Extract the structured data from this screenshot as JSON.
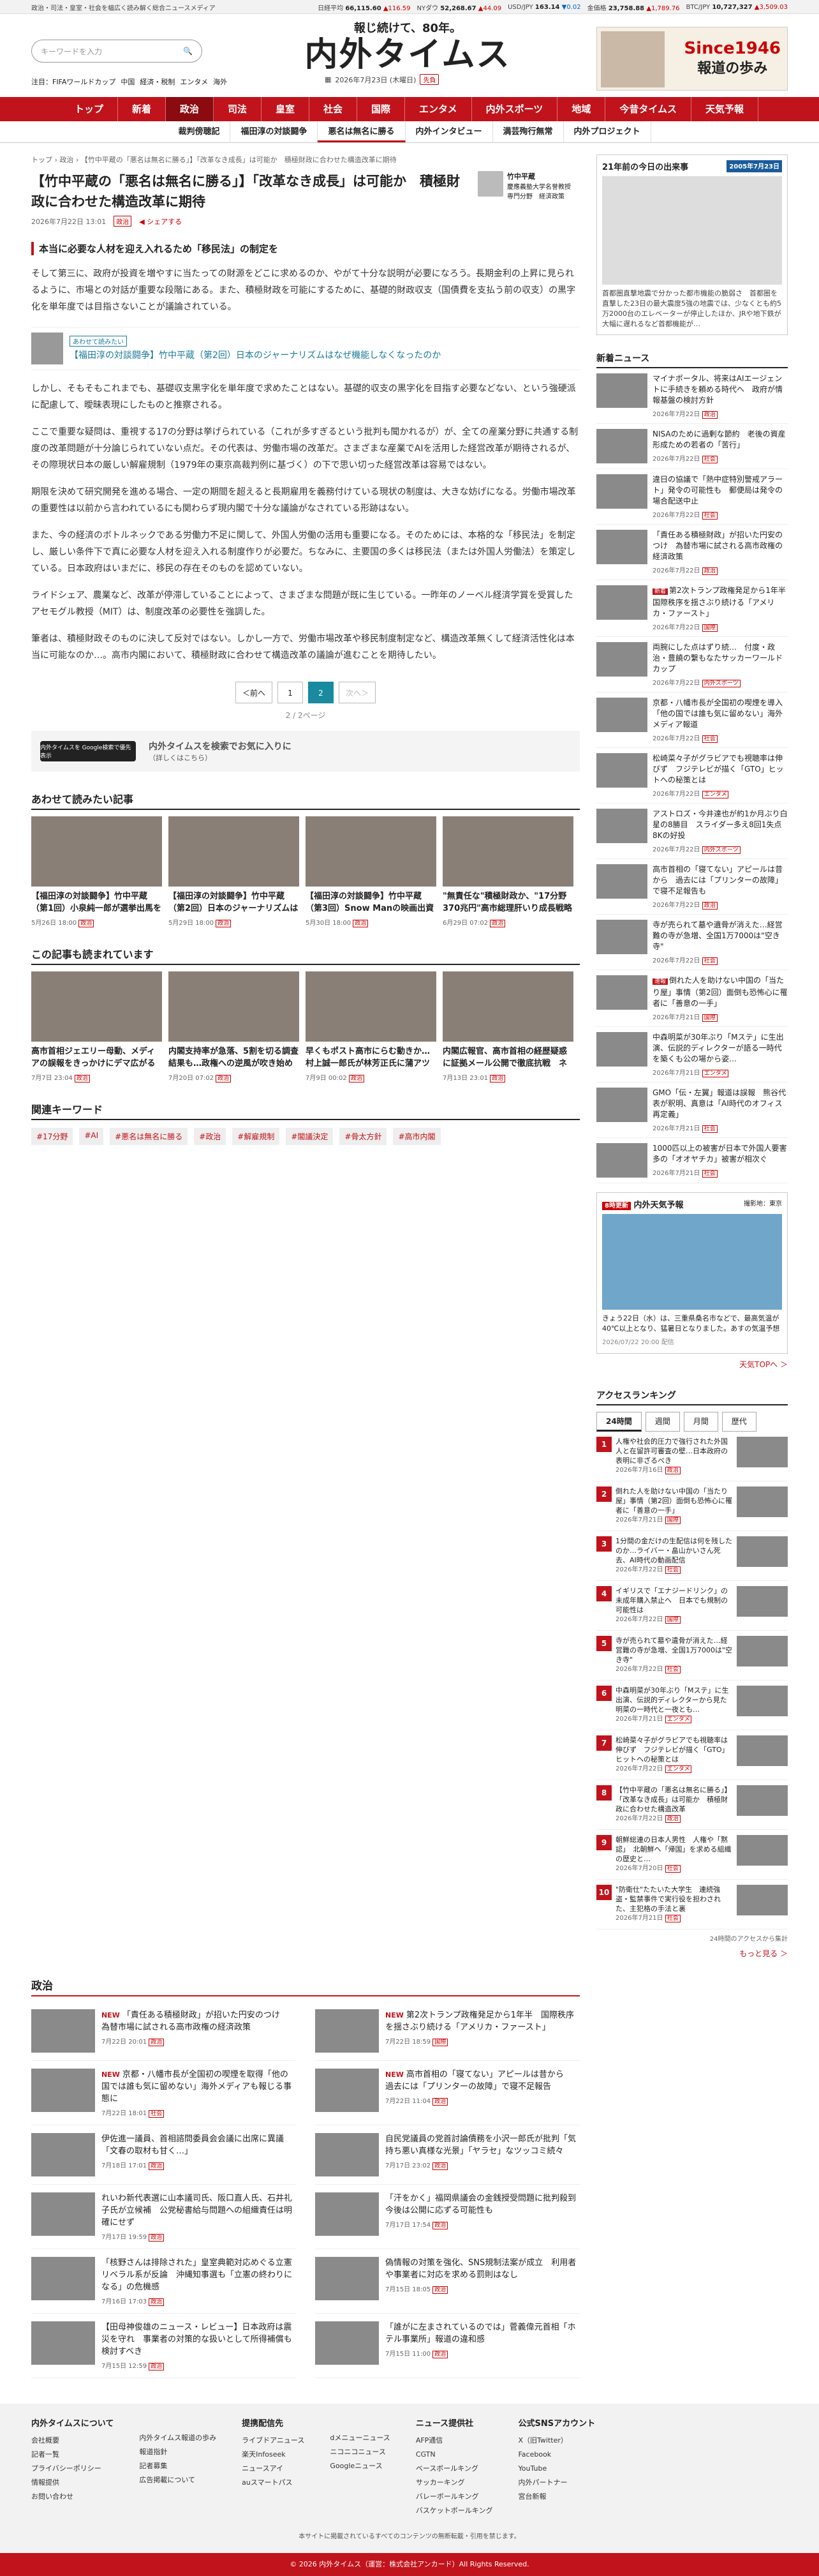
{
  "topbar": {
    "left": "政治・司法・皇室・社会を幅広く読み解く総合ニュースメディア",
    "markets": [
      {
        "name": "日経平均",
        "val": "66,115.60",
        "chg": "▲116.59",
        "dir": "up"
      },
      {
        "name": "NYダウ",
        "val": "52,268.67",
        "chg": "▲44.09",
        "dir": "up"
      },
      {
        "name": "USD/JPY",
        "val": "163.14",
        "chg": "▼0.02",
        "dir": "dn"
      },
      {
        "name": "金価格",
        "val": "23,758.88",
        "chg": "▲1,789.76",
        "dir": "up"
      },
      {
        "name": "BTC/JPY",
        "val": "10,727,327",
        "chg": "▲3,509.03",
        "dir": "up"
      }
    ]
  },
  "header": {
    "search_placeholder": "キーワードを入力",
    "tagline": "報じ続けて、80年。",
    "logo": "内外タイムス",
    "date": "2026年7月23日 (木曜日)",
    "weekday": "先負",
    "topnav": [
      "注目：FIFAワールドカップ",
      "中国",
      "経済・税制",
      "エンタメ",
      "海外"
    ],
    "ad": {
      "since": "Since1946",
      "sub": "報道の歩み"
    }
  },
  "mainnav": [
    "トップ",
    "新着",
    "政治",
    "司法",
    "皇室",
    "社会",
    "国際",
    "エンタメ",
    "内外スポーツ",
    "地域",
    "今昔タイムス",
    "天気予報"
  ],
  "mainnav_active": "政治",
  "subnav": [
    "裁判傍聴記",
    "福田淳の対談闘争",
    "悪名は無名に勝る",
    "内外インタビュー",
    "満芸殉行無常",
    "内外プロジェクト"
  ],
  "subnav_active": "悪名は無名に勝る",
  "article": {
    "breadcrumb": "トップ › 政治 › 【竹中平蔵の「悪名は無名に勝る」】「改革なき成長」は可能か　積極財政に合わせた構造改革に期待",
    "title": "【竹中平蔵の「悪名は無名に勝る」】「改革なき成長」は可能か　積極財政に合わせた構造改革に期待",
    "date": "2026年7月22日 13:01",
    "cat": "政治",
    "share": "シェアする",
    "author": {
      "name": "竹中平蔵",
      "role": "慶應義塾大学名誉教授",
      "tag": "専門分野　経済政策"
    },
    "lead": "本当に必要な人材を迎え入れるため「移民法」の制定を",
    "p1": "そして第三に、政府が投資を増やすに当たっての財源をどこに求めるのか、やがて十分な説明が必要になろう。長期金利の上昇に見られるように、市場との対話が重要な段階にある。また、積極財政を可能にするために、基礎的財政収支（国債費を支払う前の収支）の黒字化を単年度では目指さないことが議論されている。",
    "related": {
      "label": "あわせて読みたい",
      "text": "【福田淳の対談闘争】竹中平蔵（第2回）日本のジャーナリズムはなぜ機能しなくなったのか"
    },
    "p2": "しかし、そもそもこれまでも、基礎収支黒字化を単年度で求めたことはない。基礎的収支の黒字化を目指す必要などない、という強硬派に配慮して、曖昧表現にしたものと推察される。",
    "p3": "ここで重要な疑問は、重視する17の分野は挙げられている（これが多すぎるという批判も聞かれるが）が、全ての産業分野に共通する制度の改革問題が十分論じられていない点だ。その代表は、労働市場の改革だ。さまざまな産業でAIを活用した経営改革が期待されるが、その際現状日本の厳しい解雇規制（1979年の東京高裁判例に基づく）の下で思い切った経営改革は容易ではない。",
    "p4": "期限を決めて研究開発を進める場合、一定の期間を超えると長期雇用を義務付けている現状の制度は、大きな妨げになる。労働市場改革の重要性は以前から言われているにも関わらず現内閣で十分な議論がなされている形跡はない。",
    "p5": "また、今の経済のボトルネックである労働力不足に関して、外国人労働の活用も重要になる。そのためには、本格的な「移民法」を制定し、厳しい条件下で真に必要な人材を迎え入れる制度作りが必要だ。ちなみに、主要国の多くは移民法（または外国人労働法）を策定している。日本政府はいまだに、移民の存在そのものを認めていない。",
    "p6": "ライドシェア、農業など、改革が停滞していることによって、さまざまな問題が既に生じている。一昨年のノーベル経済学賞を受賞したアセモグル教授（MIT）は、制度改革の必要性を強調した。",
    "p7": "筆者は、積極財政そのものに決して反対ではない。しかし一方で、労働市場改革や移民制度制定など、構造改革無くして経済活性化は本当に可能なのか…。高市内閣において、積極財政に合わせて構造改革の議論が進むことを期待したい。",
    "pager": {
      "prev": "＜前へ",
      "p1": "1",
      "p2": "2",
      "next": "次へ＞",
      "text": "2 / 2ページ"
    },
    "google": {
      "btn": "内外タイムスを Google検索で優先表示",
      "title": "内外タイムスを検索でお気に入りに",
      "sub": "（詳しくはこちら）"
    }
  },
  "recommend": {
    "title": "あわせて読みたい記事",
    "items": [
      {
        "t": "【福田淳の対談闘争】竹中平蔵（第1回）小泉純一郎が選挙出馬を断らず…",
        "d": "5月26日 18:00",
        "c": "政治"
      },
      {
        "t": "【福田淳の対談闘争】竹中平蔵（第2回）日本のジャーナリズムはなぜ機能…",
        "d": "5月29日 18:00",
        "c": "政治"
      },
      {
        "t": "【福田淳の対談闘争】竹中平蔵（第3回）Snow Manの映画出資付が満喫…",
        "d": "5月30日 18:00",
        "c": "政治"
      },
      {
        "t": "\"無責任な\"積極財政か、\"17分野370兆円\"高市総理肝いり成長戦略投資",
        "d": "6月29日 07:02",
        "c": "政治"
      }
    ]
  },
  "popular": {
    "title": "この記事も読まれています",
    "items": [
      {
        "t": "高市首相ジェエリー母動、メディアの誤報をきっかけにデマ広がる　いまだ中傷…",
        "d": "7月7日 23:04",
        "c": "政治"
      },
      {
        "t": "内閣支持率が急落、5割を切る調査結果も…政権への逆風が吹き始めた転換点か",
        "d": "7月20日 07:02",
        "c": "政治"
      },
      {
        "t": "早くもポスト高市にらむ動きか…村上誠一郎氏が林芳正氏に蒲アツのエール",
        "d": "7月9日 00:02",
        "c": "政治"
      },
      {
        "t": "内閣広報官、高市首相の経歴疑惑に証拠メール公開で徹底抗戦　ネットは賛否…",
        "d": "7月13日 23:01",
        "c": "政治"
      }
    ]
  },
  "keywords": {
    "title": "関連キーワード",
    "items": [
      "#17分野",
      "#AI",
      "#悪名は無名に勝る",
      "#政治",
      "#解雇規制",
      "#閣議決定",
      "#骨太方針",
      "#高市内閣"
    ]
  },
  "today": {
    "title": "21年前の今日の出来事",
    "year": "2005年7月23日",
    "text": "首都圏直撃地震で分かった都市機能の脆弱さ　首都圏を直撃した23日の最大震度5強の地震では、少なくとも約5万2000台のエレベーターが停止したほか、JRや地下鉄が大幅に遅れるなど首都機能が…"
  },
  "shin": {
    "title": "新着ニュース",
    "items": [
      {
        "t": "マイナポータル、将来はAIエージェントに手続きを頼める時代へ　政府が情報基盤の検討方針",
        "d": "2026年7月22日",
        "c": "政治"
      },
      {
        "t": "NISAのために過剰な節約　老後の資産形成ための若者の「苦行」",
        "d": "2026年7月22日",
        "c": "社会"
      },
      {
        "t": "違日の協議で「熱中症特別警戒アラート」発令の可能性も　郵便局は発令の場合配送中止",
        "d": "2026年7月22日",
        "c": "社会"
      },
      {
        "t": "「責任ある積極財政」が招いた円安のつけ　為替市場に試される高市政権の経済政策",
        "d": "2026年7月22日",
        "c": "政治"
      },
      {
        "t": "第2次トランプ政権発足から1年半　国際秩序を揺さぶり続ける「アメリカ・ファースト」",
        "d": "2026年7月22日",
        "c": "国際",
        "new": "新着"
      },
      {
        "t": "両腕にした点はずり続…　付度・政治・豊饒の繋もなたサッカーワールドカップ",
        "d": "2026年7月22日",
        "c": "内外スポーツ"
      },
      {
        "t": "京都・八幡市長が全国初の喫煙を導入「他の国では誰も気に留めない」海外メディア報道",
        "d": "2026年7月22日",
        "c": "社会"
      },
      {
        "t": "松崎菜々子がグラビアでも視聴率は伸びず　フジテレビが描く「GTO」ヒットへの秘策とは",
        "d": "2026年7月22日",
        "c": "エンタメ"
      },
      {
        "t": "アストロズ・今井達也が約1か月ぶり白星の8勝目　スライダー多え8回1失点8Kの好投",
        "d": "2026年7月22日",
        "c": "内外スポーツ"
      },
      {
        "t": "高市首相の「寝てない」アピールは昔から　過去には「プリンターの故障」で寝不足報告も",
        "d": "2026年7月22日",
        "c": "政治"
      },
      {
        "t": "寺が売られて墓や遺骨が消えた…経営難の寺が急増、全国1万7000は\"空き寺\"",
        "d": "2026年7月22日",
        "c": "社会"
      },
      {
        "t": "倒れた人を助けない中国の「当たり屋」事情（第2回）面倒も恐怖心に罹者に「善意の一手」",
        "d": "2026年7月21日",
        "c": "国際",
        "new": "速報"
      },
      {
        "t": "中森明菜が30年ぶり「Mステ」に生出演、伝説的ディレクターが語る一時代を築くも公の場から姿…",
        "d": "2026年7月21日",
        "c": "エンタメ"
      },
      {
        "t": "GMO「伝・左翼」報道は誤報　熊谷代表が釈明、真意は「AI時代のオフィス再定義」",
        "d": "2026年7月21日",
        "c": "社会"
      },
      {
        "t": "1000匹以上の被害が日本で外国人要害多の「オオヤチカ」被害が相次ぐ",
        "d": "2026年7月21日",
        "c": "社会"
      }
    ]
  },
  "weather": {
    "title": "内外天気予報",
    "badge": "8時更新",
    "loc": "撮影地：東京",
    "text": "きょう22日（水）は、三重県桑名市などで、最高気温が40℃以上となり、猛暑日となりました。あすの気温予想",
    "date": "2026/07/22 20:00 配信",
    "more": "天気TOPへ ＞"
  },
  "rank": {
    "title": "アクセスランキング",
    "tabs": [
      "24時間",
      "週間",
      "月間",
      "歴代"
    ],
    "items": [
      {
        "n": "1",
        "t": "人権や社会的圧力で強行された外国人と在留許可審査の壁…日本政府の表明に非ざるべき",
        "d": "2026年7月16日",
        "c": "政治"
      },
      {
        "n": "2",
        "t": "倒れた人を助けない中国の「当たり屋」事情（第2回）面倒も恐怖心に罹者に「善意の一手」",
        "d": "2026年7月21日",
        "c": "国際"
      },
      {
        "n": "3",
        "t": "1分間の金だけの生配信は何を残したのか…ライバー・畠山かいさん死去、AI時代の動画配信",
        "d": "2026年7月22日",
        "c": "社会"
      },
      {
        "n": "4",
        "t": "イギリスで「エナジードリンク」の未成年購入禁止へ　日本でも規制の可能性は",
        "d": "2026年7月22日",
        "c": "国際"
      },
      {
        "n": "5",
        "t": "寺が売られて墓や遺骨が消えた…経営難の寺が急増、全国1万7000は\"空き寺\"",
        "d": "2026年7月22日",
        "c": "社会"
      },
      {
        "n": "6",
        "t": "中森明菜が30年ぶり「Mステ」に生出演、伝説的ディレクターから見た明菜の一時代と一夜とも…",
        "d": "2026年7月21日",
        "c": "エンタメ"
      },
      {
        "n": "7",
        "t": "松崎菜々子がグラビアでも視聴率は伸びず　フジテレビが描く「GTO」ヒットへの秘策とは",
        "d": "2026年7月22日",
        "c": "エンタメ"
      },
      {
        "n": "8",
        "t": "【竹中平蔵の「悪名は無名に勝る」】「改革なき成長」は可能か　積極財政に合わせた構造改革",
        "d": "2026年7月22日",
        "c": "政治"
      },
      {
        "n": "9",
        "t": "朝鮮総連の日本人男性　人権や「黙認」　北朝鮮へ「帰国」を求める組織の歴史と…",
        "d": "2026年7月20日",
        "c": "社会"
      },
      {
        "n": "10",
        "t": "\"防衛仕\"たたいた大学生　連続強盗・監禁事件で実行役を担わされた、主犯格の手法と裏",
        "d": "2026年7月21日",
        "c": "社会"
      }
    ],
    "note": "24時間のアクセスから集計",
    "more": "もっと見る ＞"
  },
  "politics": {
    "title": "政治",
    "items": [
      {
        "t": "「責任ある積極財政」が招いた円安のつけ　為替市場に試される高市政権の経済政策",
        "d": "7月22日 20:01",
        "c": "政治",
        "new": "NEW"
      },
      {
        "t": "第2次トランプ政権発足から1年半　国際秩序を揺さぶり続ける「アメリカ・ファースト」",
        "d": "7月22日 18:59",
        "c": "国際",
        "new": "NEW"
      },
      {
        "t": "京都・八幡市長が全国初の喫煙を取得「他の国では誰も気に留めない」海外メディアも報じる事態に",
        "d": "7月22日 18:01",
        "c": "社会",
        "new": "NEW"
      },
      {
        "t": "高市首相の「寝てない」アピールは昔から　過去には「プリンターの故障」で寝不足報告",
        "d": "7月22日 11:04",
        "c": "政治",
        "new": "NEW"
      },
      {
        "t": "伊佐進一議員、首相諮問委員会会議に出席に異議「文春の取材も甘く…」",
        "d": "7月18日 17:01",
        "c": "政治"
      },
      {
        "t": "自民党議員の党首討論債務を小沢一郎氏が批判「気持ち悪い真様な光景」「ヤラセ」なツッコミ続々",
        "d": "7月17日 23:02",
        "c": "政治"
      },
      {
        "t": "れいわ新代表選に山本議司氏、阪口直人氏、石井礼子氏が立候補　公党秘書給与問題への組織責任は明確にせず",
        "d": "7月17日 19:59",
        "c": "政治"
      },
      {
        "t": "「汗をかく」福岡県議会の金銭授受問題に批判殺到　今後は公開に応ずる可能性も",
        "d": "7月17日 17:54",
        "c": "政治"
      },
      {
        "t": "「核野さんは排除された」皇室典範対応めぐる立憲リベラル系が反論　沖縄知事選も「立憲の終わりになる」の危機感",
        "d": "7月16日 17:03",
        "c": "政治"
      },
      {
        "t": "偽情報の対策を強化、SNS規制法案が成立　利用者や事業者に対応を求める罰則はなし",
        "d": "7月15日 18:05",
        "c": "政治"
      },
      {
        "t": "【田母神俊雄のニュース・レビュー】日本政府は震災を守れ　事業者の対策的な扱いとして所得補償も検討すべき",
        "d": "7月15日 12:59",
        "c": "政治"
      },
      {
        "t": "「誰がに左まされているのでは」菅義偉元首相「ホテル事業所」報道の違和感",
        "d": "7月15日 11:00",
        "c": "政治"
      }
    ]
  },
  "footer": {
    "cols": [
      {
        "h": "内外タイムスについて",
        "items": [
          "会社概要",
          "記者一覧",
          "プライバシーポリシー",
          "情報提供",
          "お問い合わせ"
        ]
      },
      {
        "h": "",
        "items": [
          "内外タイムス報道の歩み",
          "報道指針",
          "記者募集",
          "広告掲載について"
        ]
      },
      {
        "h": "提携配信先",
        "items": [
          "ライブドアニュース",
          "楽天Infoseek",
          "ニュースアイ",
          "auスマートパス"
        ]
      },
      {
        "h": "",
        "items": [
          "dメニューニュース",
          "ニコニコニュース",
          "Googleニュース"
        ]
      },
      {
        "h": "ニュース提供社",
        "items": [
          "AFP通信",
          "CGTN",
          "ベースボールキング",
          "サッカーキング",
          "バレーボールキング",
          "バスケットボールキング"
        ]
      },
      {
        "h": "公式SNSアカウント",
        "items": [
          "X（旧Twitter）",
          "Facebook",
          "YouTube",
          "内外パートナー",
          "宮台新報"
        ]
      }
    ],
    "note": "本サイトに掲載されているすべてのコンテンツの無断転載・引用を禁じます。",
    "copy": "© 2026 内外タイムス（運営：株式会社アンカード）All Rights Reserved."
  }
}
